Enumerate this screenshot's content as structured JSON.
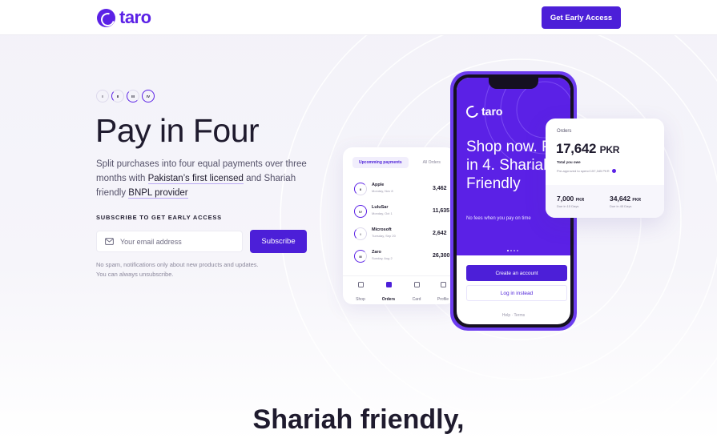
{
  "header": {
    "logo_text": "taro",
    "cta_label": "Get Early Access"
  },
  "hero": {
    "steps": [
      "I",
      "II",
      "III",
      "IV"
    ],
    "title": "Pay in Four",
    "desc_part1": "Split purchases into four equal payments over three months with ",
    "desc_highlight1": "Pakistan’s first licensed",
    "desc_part2": " and Shariah friendly ",
    "desc_highlight2": "BNPL provider",
    "subscribe_label": "SUBSCRIBE TO GET EARLY ACCESS",
    "email_placeholder": "Your email address",
    "subscribe_button": "Subscribe",
    "fineprint_line1": "No spam, notifications only about new products and updates.",
    "fineprint_line2": "You can always unsubscribe."
  },
  "orders_card": {
    "tabs": [
      "Upcomming payments",
      "All Orders"
    ],
    "orders": [
      {
        "step": "II",
        "name": "Apple",
        "date": "Monday, Nov 8",
        "amount": "3,462"
      },
      {
        "step": "IV",
        "name": "LuluSar",
        "date": "Monday, Oct 1",
        "amount": "11,635"
      },
      {
        "step": "I",
        "name": "Microsoft",
        "date": "Tuesday, Sep 20",
        "amount": "2,642"
      },
      {
        "step": "III",
        "name": "Zaro",
        "date": "Sunday, Aug 2",
        "amount": "26,300"
      }
    ],
    "nav": [
      "Shop",
      "Orders",
      "Card",
      "Profile"
    ]
  },
  "phone": {
    "logo_text": "taro",
    "headline": "Shop now. Pay in 4. Shariah Friendly",
    "tagline": "No fees when you pay on time",
    "create_button": "Create an account",
    "login_button": "Log in instead",
    "help_text": "Help · Terms"
  },
  "summary_card": {
    "label": "Orders",
    "total": "17,642",
    "currency": "PKR",
    "sub": "Total you owe",
    "preapproved": "Pre-approved to spend 157,345 PKR",
    "split_1_amount": "7,000",
    "split_1_due": "Due in 15 Days",
    "split_2_amount": "34,642",
    "split_2_due": "Due in 45 Days"
  },
  "section": {
    "title": "Shariah friendly,"
  },
  "colors": {
    "brand": "#5b21e6",
    "button": "#4c1fd8",
    "text": "#1f1b2e"
  }
}
